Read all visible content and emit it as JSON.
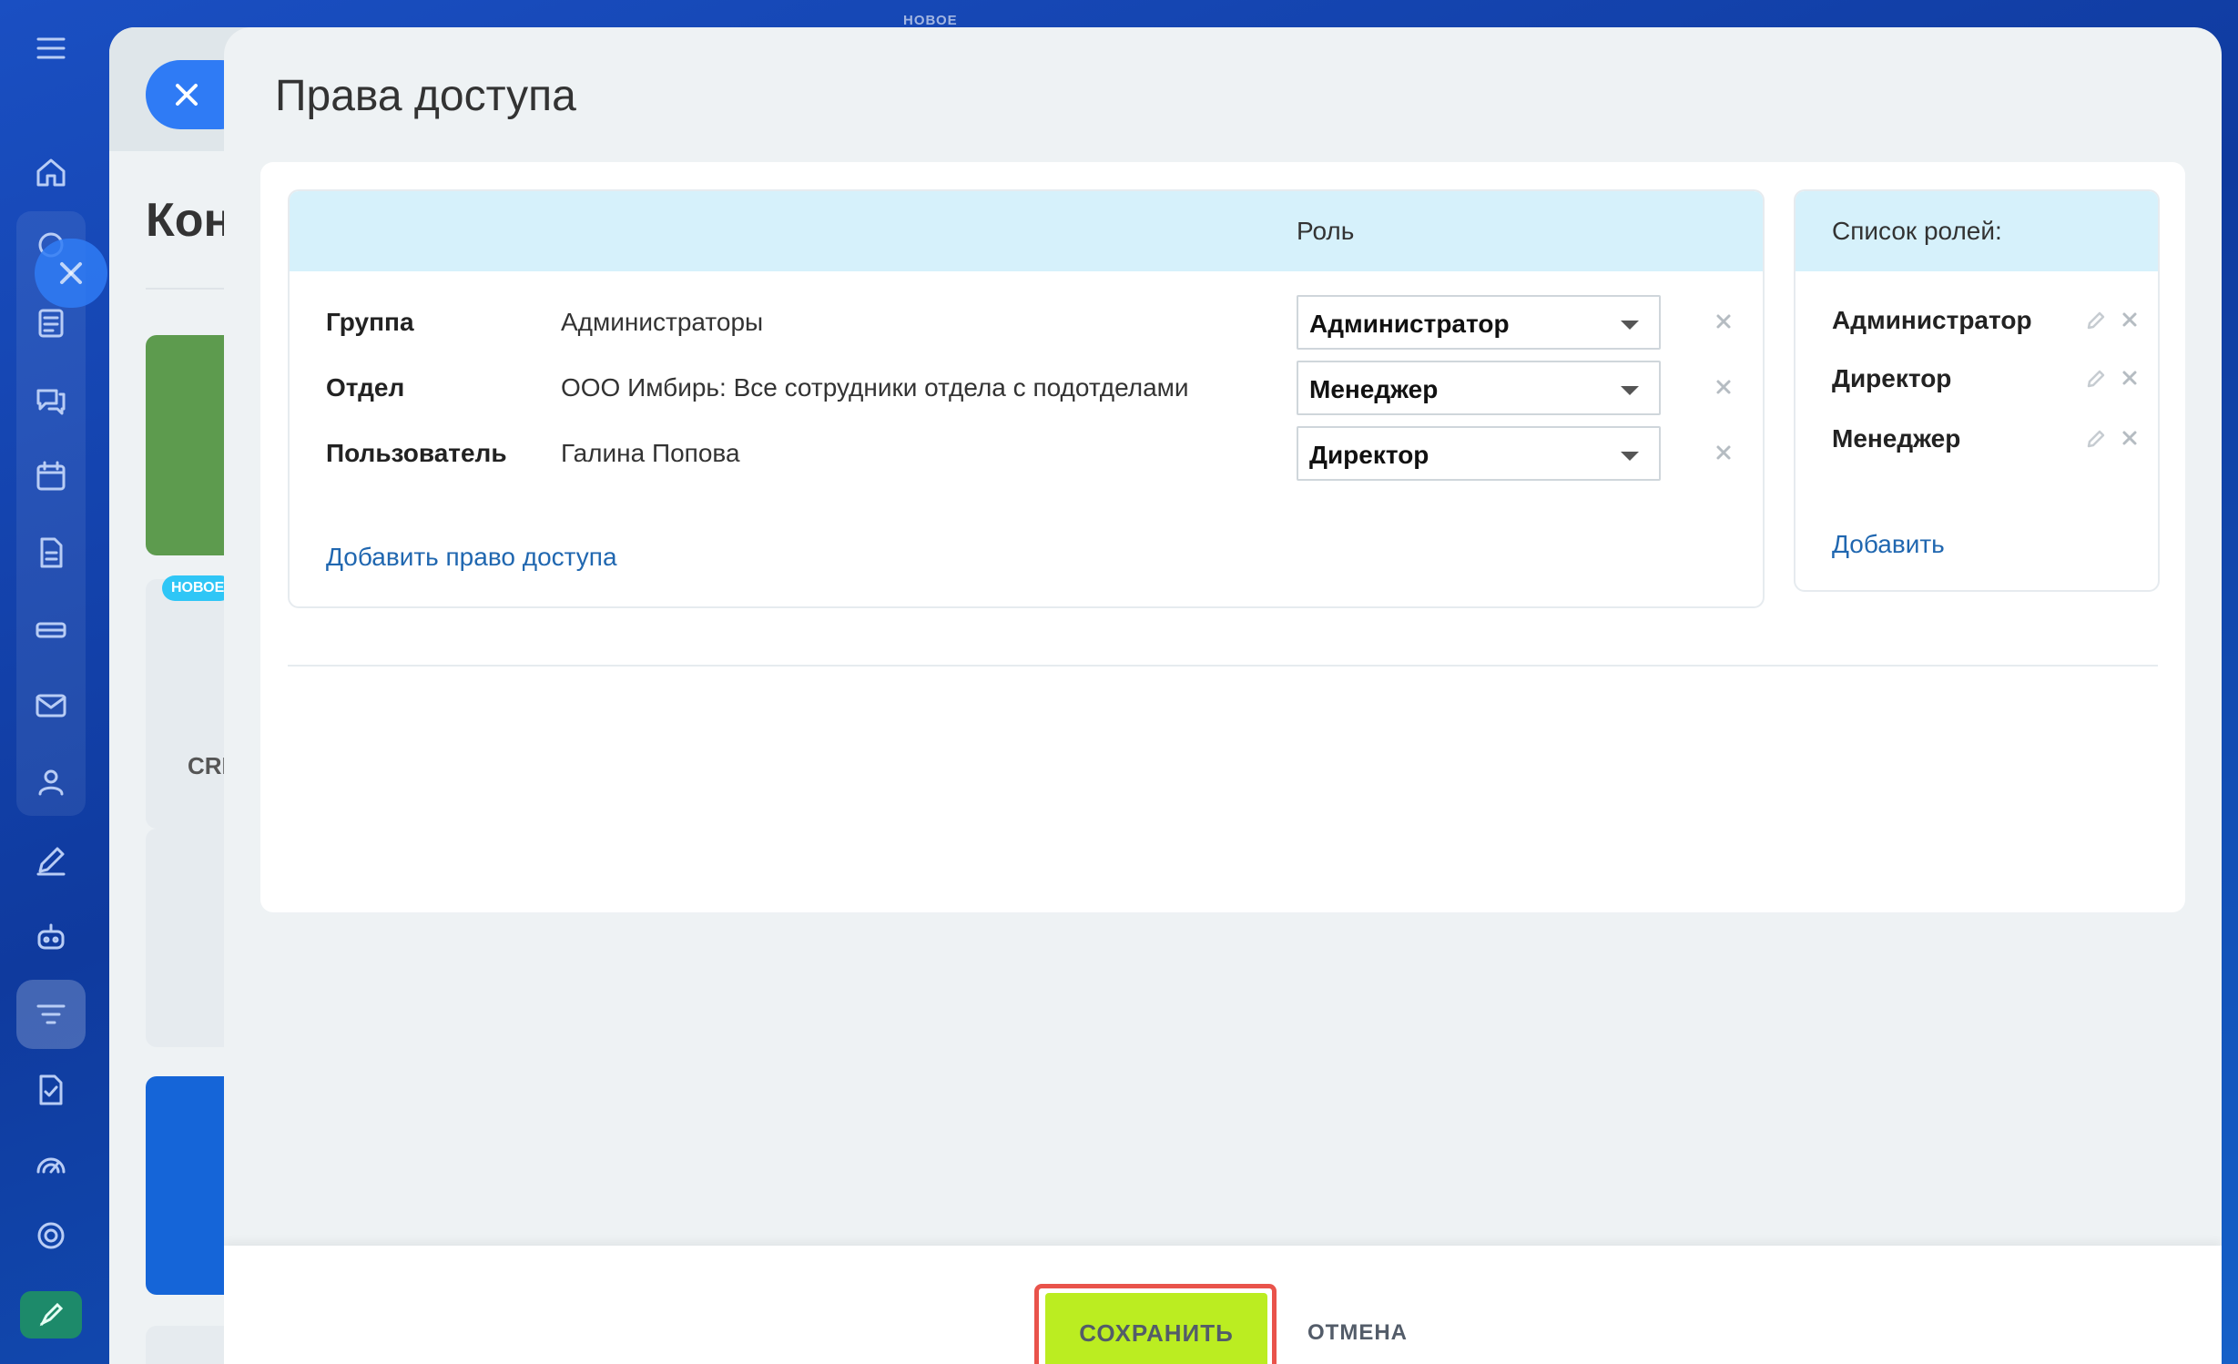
{
  "background": {
    "new_label_top": "НОВОЕ",
    "page_title_fragment": "Кон",
    "badge_fragment": "НОВОЕ",
    "crm_fragment": "CRI"
  },
  "sidebar": {
    "icons": [
      "menu-icon",
      "home-icon",
      "activity-icon",
      "news-icon",
      "chat-icon",
      "calendar-icon",
      "docs-icon",
      "drive-icon",
      "mail-icon",
      "contacts-icon",
      "sign-icon",
      "robot-icon",
      "filter-icon",
      "tasks-icon",
      "analytics-icon",
      "settings-icon",
      "rocket-icon"
    ],
    "active": "filter-icon"
  },
  "slider": {
    "title": "Права доступа",
    "permissions": {
      "role_header": "Роль",
      "rows": [
        {
          "type": "Группа",
          "name": "Администраторы",
          "role": "Администратор"
        },
        {
          "type": "Отдел",
          "name": "ООО Имбирь: Все сотрудники отдела с подотделами",
          "role": "Менеджер"
        },
        {
          "type": "Пользователь",
          "name": "Галина Попова",
          "role": "Директор"
        }
      ],
      "add_link": "Добавить право доступа"
    },
    "roles": {
      "header": "Список ролей:",
      "items": [
        "Администратор",
        "Директор",
        "Менеджер"
      ],
      "add_link": "Добавить"
    }
  },
  "footer": {
    "save_label": "СОХРАНИТЬ",
    "cancel_label": "ОТМЕНА",
    "save_color": "#bbed21",
    "highlight_color": "#e9534b"
  }
}
